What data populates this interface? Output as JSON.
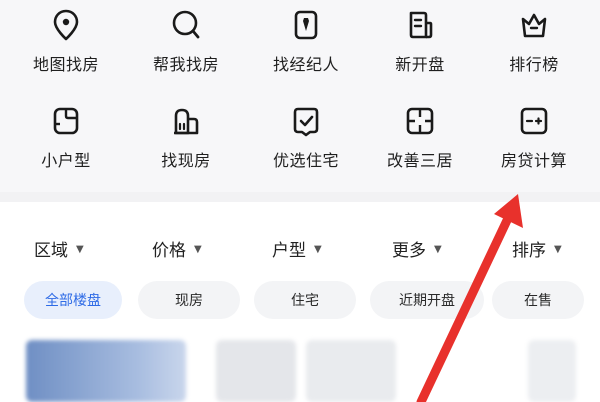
{
  "shortcuts": [
    {
      "label": "地图找房",
      "icon": "map-pin-icon"
    },
    {
      "label": "帮我找房",
      "icon": "search-icon"
    },
    {
      "label": "找经纪人",
      "icon": "agent-badge-icon"
    },
    {
      "label": "新开盘",
      "icon": "new-listing-icon"
    },
    {
      "label": "排行榜",
      "icon": "crown-icon"
    },
    {
      "label": "小户型",
      "icon": "small-unit-icon"
    },
    {
      "label": "找现房",
      "icon": "building-icon"
    },
    {
      "label": "优选住宅",
      "icon": "checked-home-icon"
    },
    {
      "label": "改善三居",
      "icon": "floorplan-icon"
    },
    {
      "label": "房贷计算",
      "icon": "calculator-icon"
    }
  ],
  "filters": [
    {
      "label": "区域"
    },
    {
      "label": "价格"
    },
    {
      "label": "户型"
    },
    {
      "label": "更多"
    },
    {
      "label": "排序"
    }
  ],
  "chips": [
    {
      "label": "全部楼盘",
      "active": true
    },
    {
      "label": "现房",
      "active": false
    },
    {
      "label": "住宅",
      "active": false
    },
    {
      "label": "近期开盘",
      "active": false
    },
    {
      "label": "在售",
      "active": false
    }
  ],
  "colors": {
    "accent": "#2e6be6",
    "arrow": "#e8312c",
    "chip_active_bg": "#e8effc"
  }
}
